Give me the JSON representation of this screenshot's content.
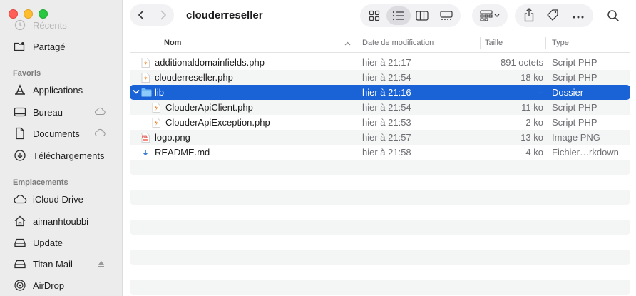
{
  "sidebar": {
    "recents_label": "Récents",
    "shared_label": "Partagé",
    "favorites_title": "Favoris",
    "favorites": [
      {
        "label": "Applications"
      },
      {
        "label": "Bureau"
      },
      {
        "label": "Documents"
      },
      {
        "label": "Téléchargements"
      }
    ],
    "locations_title": "Emplacements",
    "locations": [
      {
        "label": "iCloud Drive"
      },
      {
        "label": "aimanhtoubbi"
      },
      {
        "label": "Update"
      },
      {
        "label": "Titan Mail"
      },
      {
        "label": "AirDrop"
      }
    ]
  },
  "toolbar": {
    "title": "clouderreseller",
    "active_view": "list"
  },
  "columns": {
    "name": "Nom",
    "date": "Date de modification",
    "size": "Taille",
    "kind": "Type"
  },
  "files": [
    {
      "name": "additionaldomainfields.php",
      "date": "hier à 21:17",
      "size": "891 octets",
      "kind": "Script PHP",
      "icon": "php-file-icon",
      "indent": 0
    },
    {
      "name": "clouderreseller.php",
      "date": "hier à 21:54",
      "size": "18 ko",
      "kind": "Script PHP",
      "icon": "php-file-icon",
      "indent": 0
    },
    {
      "name": "lib",
      "date": "hier à 21:16",
      "size": "--",
      "kind": "Dossier",
      "icon": "folder-icon",
      "indent": 0,
      "selected": true,
      "expanded": true
    },
    {
      "name": "ClouderApiClient.php",
      "date": "hier à 21:54",
      "size": "11 ko",
      "kind": "Script PHP",
      "icon": "php-file-icon",
      "indent": 1
    },
    {
      "name": "ClouderApiException.php",
      "date": "hier à 21:53",
      "size": "2 ko",
      "kind": "Script PHP",
      "icon": "php-file-icon",
      "indent": 1
    },
    {
      "name": "logo.png",
      "date": "hier à 21:57",
      "size": "13 ko",
      "kind": "Image PNG",
      "icon": "png-file-icon",
      "indent": 0
    },
    {
      "name": "README.md",
      "date": "hier à 21:58",
      "size": "4 ko",
      "kind": "Fichier…rkdown",
      "icon": "markdown-file-icon",
      "indent": 0
    }
  ],
  "colors": {
    "selection": "#1a63d6",
    "close": "#ff5f57",
    "minimize": "#febc2e",
    "maximize": "#28c840"
  }
}
